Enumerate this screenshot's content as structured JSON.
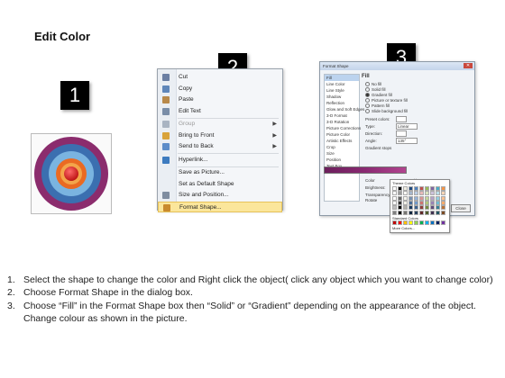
{
  "title": "Edit Color",
  "badges": [
    "1",
    "2",
    "3"
  ],
  "target_colors": [
    "#8b2c6d",
    "#3b6fb0",
    "#7ab4e0",
    "#ea6a22",
    "#f3a54a",
    "#d81c1c"
  ],
  "context_menu": {
    "items": [
      {
        "label": "Cut",
        "icon": "scissors-icon",
        "disabled": false,
        "submenu": false,
        "highlight": false,
        "color": "#6b7fa3"
      },
      {
        "label": "Copy",
        "icon": "copy-icon",
        "disabled": false,
        "submenu": false,
        "highlight": false,
        "color": "#5f86b9"
      },
      {
        "label": "Paste",
        "icon": "paste-icon",
        "disabled": false,
        "submenu": false,
        "highlight": false,
        "color": "#b8894a"
      },
      {
        "label": "Edit Text",
        "icon": "edit-text-icon",
        "disabled": false,
        "submenu": false,
        "highlight": false,
        "color": "#7a8ea8"
      },
      {
        "label": "Group",
        "icon": "group-icon",
        "disabled": true,
        "submenu": true,
        "highlight": false,
        "color": "#a9b4c2"
      },
      {
        "label": "Bring to Front",
        "icon": "bring-front-icon",
        "disabled": false,
        "submenu": true,
        "highlight": false,
        "color": "#d9a33a"
      },
      {
        "label": "Send to Back",
        "icon": "send-back-icon",
        "disabled": false,
        "submenu": true,
        "highlight": false,
        "color": "#5c8cc9"
      },
      {
        "label": "Hyperlink...",
        "icon": "hyperlink-icon",
        "disabled": false,
        "submenu": false,
        "highlight": false,
        "color": "#3d7bbf"
      },
      {
        "label": "Save as Picture...",
        "icon": "",
        "disabled": false,
        "submenu": false,
        "highlight": false,
        "color": ""
      },
      {
        "label": "Set as Default Shape",
        "icon": "",
        "disabled": false,
        "submenu": false,
        "highlight": false,
        "color": ""
      },
      {
        "label": "Size and Position...",
        "icon": "size-position-icon",
        "disabled": false,
        "submenu": false,
        "highlight": false,
        "color": "#7f8da0"
      },
      {
        "label": "Format Shape...",
        "icon": "format-shape-icon",
        "disabled": false,
        "submenu": false,
        "highlight": true,
        "color": "#c98a2e"
      }
    ]
  },
  "dialog": {
    "title": "Format Shape",
    "categories": [
      "Fill",
      "Line Color",
      "Line Style",
      "Shadow",
      "Reflection",
      "Glow and Soft Edges",
      "3-D Format",
      "3-D Rotation",
      "Picture Corrections",
      "Picture Color",
      "Artistic Effects",
      "Crop",
      "Size",
      "Position",
      "Text Box",
      "Alt Text"
    ],
    "selected_category": "Fill",
    "fill_heading": "Fill",
    "fill_options": [
      "No fill",
      "Solid fill",
      "Gradient fill",
      "Picture or texture fill",
      "Pattern fill",
      "Slide background fill"
    ],
    "selected_fill": "Gradient fill",
    "fields": [
      {
        "label": "Preset colors:",
        "value": ""
      },
      {
        "label": "Type:",
        "value": "Linear"
      },
      {
        "label": "Direction:",
        "value": ""
      },
      {
        "label": "Angle:",
        "value": "135°"
      },
      {
        "label": "Gradient stops",
        "value": ""
      }
    ],
    "color_label": "Color",
    "position_label": "Position:",
    "position_value": "100%",
    "brightness_label": "Brightness:",
    "transparency_label": "Transparency:",
    "rotate_label": "Rotate",
    "close_label": "Close"
  },
  "palette": {
    "theme_label": "Theme Colors",
    "standard_label": "Standard Colors",
    "more_label": "More Colors...",
    "theme_colors": [
      "#ffffff",
      "#000000",
      "#eeece1",
      "#1f497d",
      "#4f81bd",
      "#c0504d",
      "#9bbb59",
      "#8064a2",
      "#4bacc6",
      "#f79646"
    ],
    "standard_colors": [
      "#c00000",
      "#ff0000",
      "#ffc000",
      "#ffff00",
      "#92d050",
      "#00b050",
      "#00b0f0",
      "#0070c0",
      "#002060",
      "#7030a0"
    ]
  },
  "instructions": [
    {
      "num": "1.",
      "text": "Select the shape to change the color and Right click the object( click any object which you want to change color)"
    },
    {
      "num": "2.",
      "text": "Choose Format Shape in the dialog box."
    },
    {
      "num": "3.",
      "text": "Choose “Fill” in the Format Shape box then “Solid” or “Gradient” depending on the appearance of the object. Change colour as shown in the picture."
    }
  ]
}
